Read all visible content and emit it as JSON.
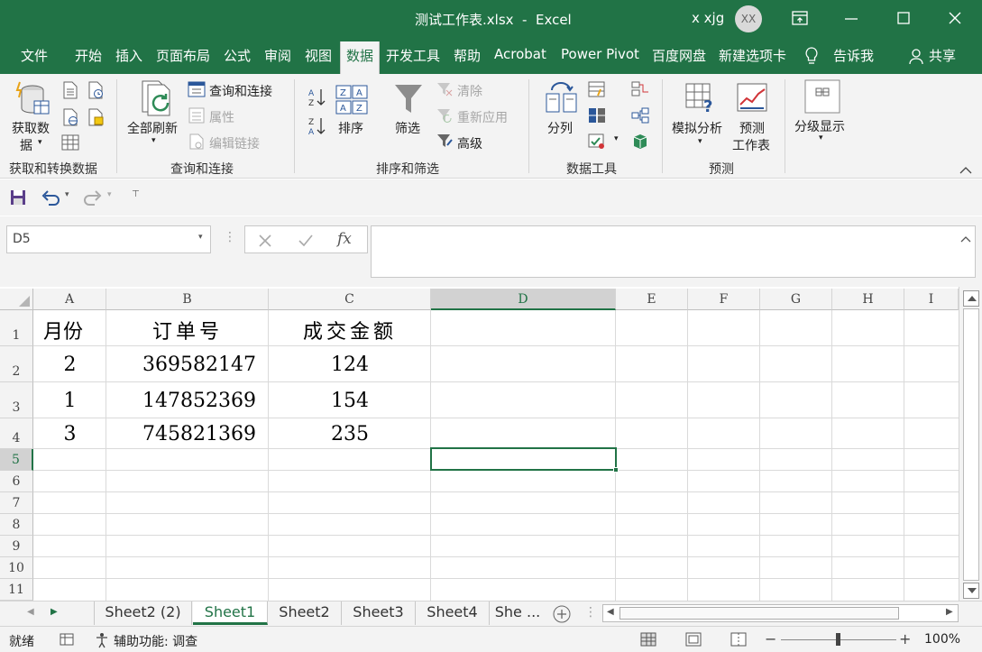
{
  "window": {
    "title": "测试工作表.xlsx  -  Excel",
    "user_name": "x xjg",
    "user_initials": "XX"
  },
  "ribbon_tabs": [
    "文件",
    "开始",
    "插入",
    "页面布局",
    "公式",
    "审阅",
    "视图",
    "数据",
    "开发工具",
    "帮助",
    "Acrobat",
    "Power Pivot",
    "百度网盘",
    "新建选项卡"
  ],
  "active_tab": "数据",
  "tell_me": "告诉我",
  "share": "共享",
  "ribbon": {
    "get_data": {
      "line1": "获取数",
      "line2": "据",
      "group": "获取和转换数据"
    },
    "queries": {
      "refresh_all": "全部刷新",
      "queries_connections": "查询和连接",
      "properties": "属性",
      "edit_links": "编辑链接",
      "group": "查询和连接"
    },
    "sort_filter": {
      "sort": "排序",
      "filter": "筛选",
      "clear": "清除",
      "reapply": "重新应用",
      "advanced": "高级",
      "group": "排序和筛选"
    },
    "data_tools": {
      "text_to_columns": "分列",
      "group": "数据工具"
    },
    "forecast": {
      "what_if": "模拟分析",
      "forecast_sheet_1": "预测",
      "forecast_sheet_2": "工作表",
      "group": "预测"
    },
    "outline": {
      "label": "分级显示"
    }
  },
  "formula_bar": {
    "name_box": "D5",
    "fx": "fx",
    "formula": ""
  },
  "columns": [
    "A",
    "B",
    "C",
    "D",
    "E",
    "F",
    "G",
    "H",
    "I"
  ],
  "selected_column": "D",
  "selected_row": "5",
  "rows": [
    "1",
    "2",
    "3",
    "4",
    "5",
    "6",
    "7",
    "8",
    "9",
    "10",
    "11"
  ],
  "cells": {
    "A1": "月份",
    "B1": "订单号",
    "C1": "成交金额",
    "A2": "2",
    "B2": "369582147",
    "C2": "124",
    "A3": "1",
    "B3": "147852369",
    "C3": "154",
    "A4": "3",
    "B4": "745821369",
    "C4": "235"
  },
  "sheets": [
    "Sheet2 (2)",
    "Sheet1",
    "Sheet2",
    "Sheet3",
    "Sheet4",
    "She ..."
  ],
  "active_sheet": "Sheet1",
  "status": {
    "ready": "就绪",
    "accessibility": "辅助功能: 调查",
    "zoom": "100%"
  },
  "colors": {
    "excel_green": "#217346",
    "ribbon_bg": "#f3f3f3",
    "selection": "#217346"
  }
}
